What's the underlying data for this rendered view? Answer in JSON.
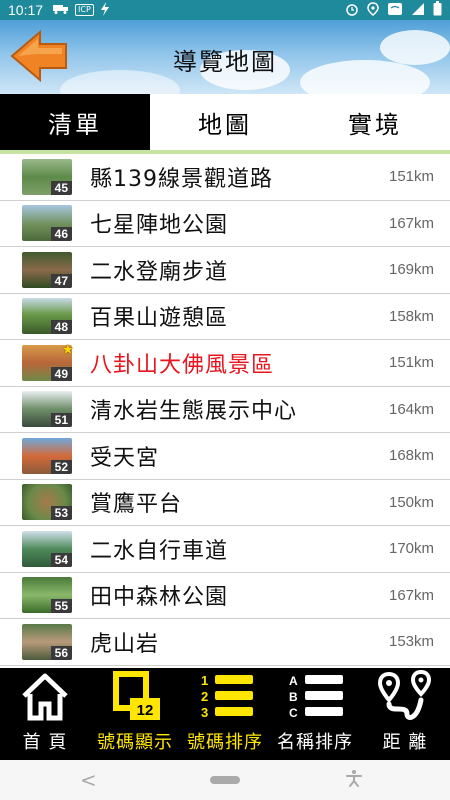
{
  "status_bar": {
    "time": "10:17",
    "left_icons": [
      "truck-icon",
      "icp-icon",
      "lightning-icon"
    ],
    "icp_text": "ICP",
    "right_icons": [
      "alarm-icon",
      "location-icon",
      "wifi-icon",
      "signal-icon",
      "battery-icon"
    ]
  },
  "header": {
    "title": "導覽地圖",
    "back_icon": "back-arrow-icon",
    "accent": "#f08424"
  },
  "tabs": [
    {
      "label": "清單",
      "active": true
    },
    {
      "label": "地圖",
      "active": false
    },
    {
      "label": "實境",
      "active": false
    }
  ],
  "list": [
    {
      "num": "45",
      "name": "縣139線景觀道路",
      "distance": "151km",
      "highlight": false
    },
    {
      "num": "46",
      "name": "七星陣地公園",
      "distance": "167km",
      "highlight": false
    },
    {
      "num": "47",
      "name": "二水登廟步道",
      "distance": "169km",
      "highlight": false
    },
    {
      "num": "48",
      "name": "百果山遊憩區",
      "distance": "158km",
      "highlight": false
    },
    {
      "num": "49",
      "name": "八卦山大佛風景區",
      "distance": "151km",
      "highlight": true
    },
    {
      "num": "51",
      "name": "清水岩生態展示中心",
      "distance": "164km",
      "highlight": false
    },
    {
      "num": "52",
      "name": "受天宮",
      "distance": "168km",
      "highlight": false
    },
    {
      "num": "53",
      "name": "賞鷹平台",
      "distance": "150km",
      "highlight": false
    },
    {
      "num": "54",
      "name": "二水自行車道",
      "distance": "170km",
      "highlight": false
    },
    {
      "num": "55",
      "name": "田中森林公園",
      "distance": "167km",
      "highlight": false
    },
    {
      "num": "56",
      "name": "虎山岩",
      "distance": "153km",
      "highlight": false
    }
  ],
  "bottom_nav": [
    {
      "label": "首 頁",
      "icon": "home-icon",
      "yellow": false
    },
    {
      "label": "號碼顯示",
      "icon": "number-display-icon",
      "yellow": true,
      "badge": "12"
    },
    {
      "label": "號碼排序",
      "icon": "number-sort-icon",
      "yellow": true,
      "digits": [
        "1",
        "2",
        "3"
      ]
    },
    {
      "label": "名稱排序",
      "icon": "name-sort-icon",
      "yellow": false,
      "letters": [
        "A",
        "B",
        "C"
      ]
    },
    {
      "label": "距 離",
      "icon": "distance-route-icon",
      "yellow": false
    }
  ],
  "colors": {
    "highlight": "#e8141e",
    "nav_yellow": "#ffe600",
    "tab_active_bg": "#000000",
    "status_bar": "#1f8a9c"
  }
}
